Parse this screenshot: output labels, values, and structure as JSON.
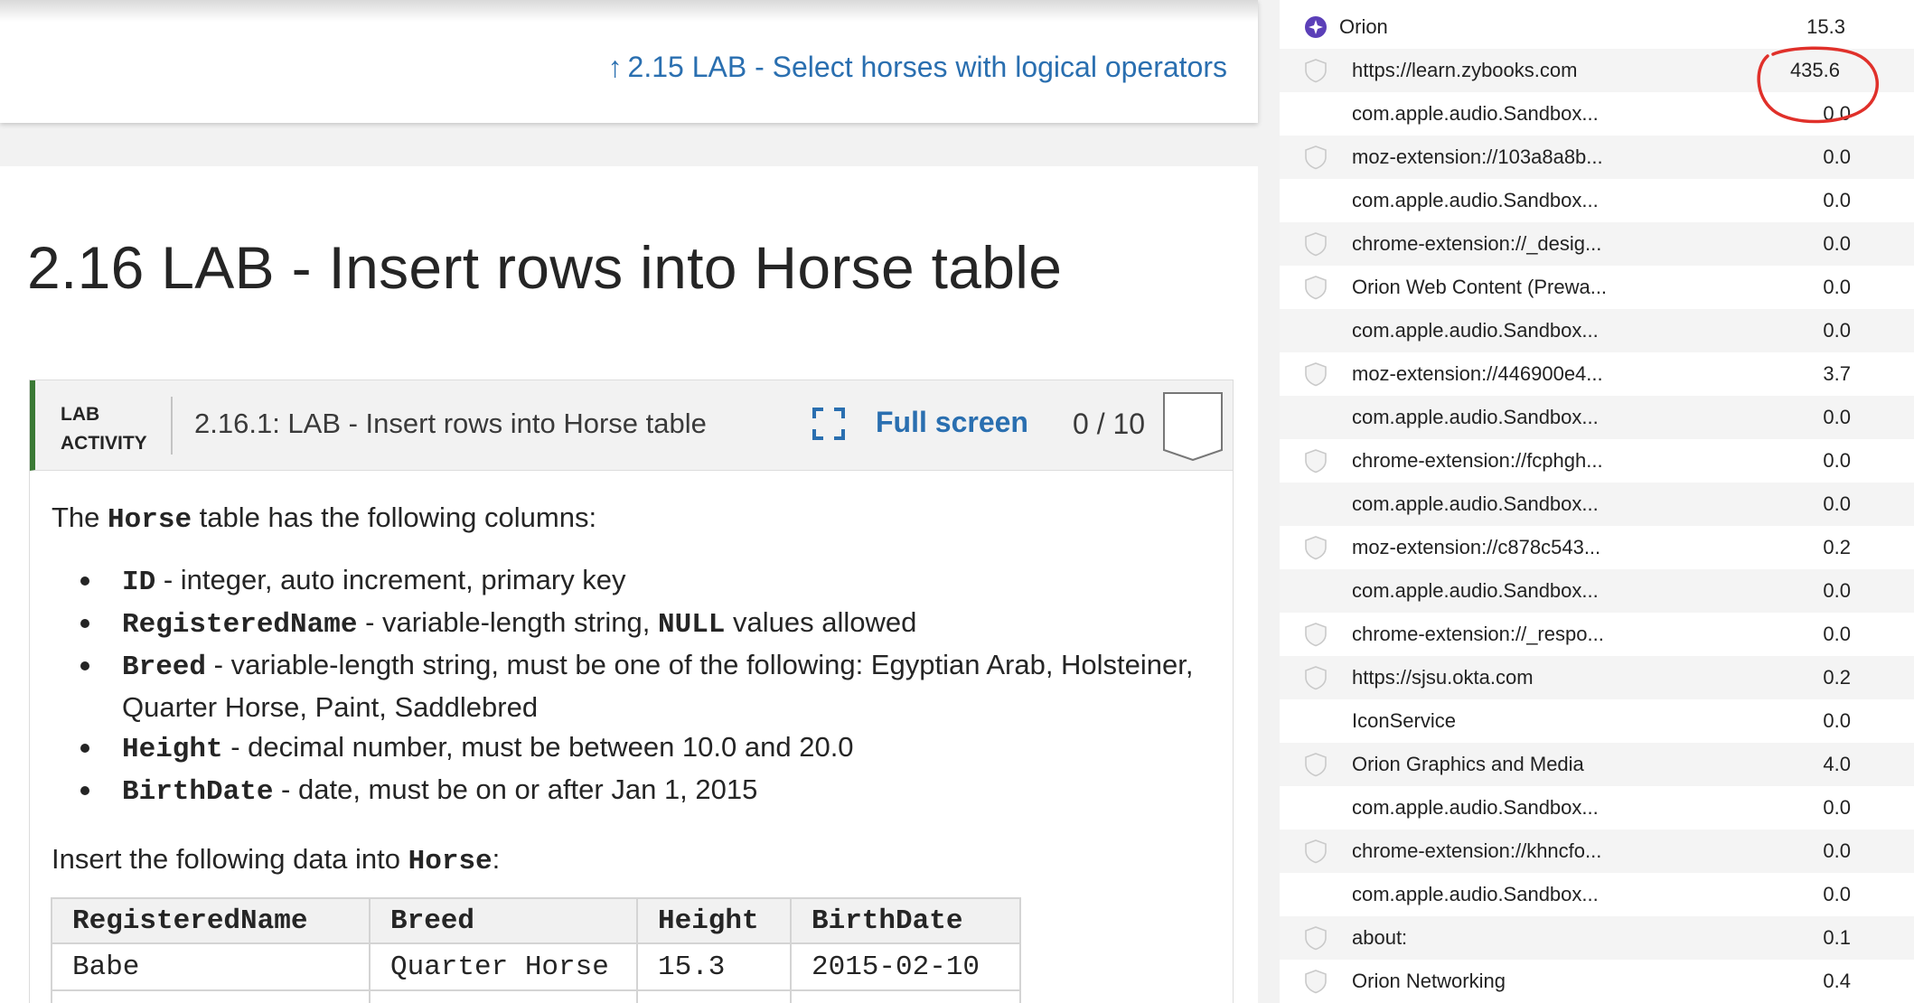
{
  "book": {
    "prev_section": "2.15 LAB - Select horses with logical operators",
    "title": "2.16 LAB - Insert rows into Horse table"
  },
  "lab": {
    "tag_line1": "LAB",
    "tag_line2": "ACTIVITY",
    "name": "2.16.1: LAB - Insert rows into Horse table",
    "fullscreen_label": "Full screen",
    "score": "0 / 10",
    "intro_pre": "The ",
    "intro_code": "Horse",
    "intro_post": " table has the following columns:",
    "columns": [
      {
        "code": "ID",
        "text": " - integer, auto increment, primary key"
      },
      {
        "code": "RegisteredName",
        "text": " - variable-length string, ",
        "code2": "NULL",
        "text2": " values allowed"
      },
      {
        "code": "Breed",
        "text": " - variable-length string, must be one of the following: Egyptian Arab, Holsteiner, Quarter Horse, Paint, Saddlebred"
      },
      {
        "code": "Height",
        "text": " - decimal number, must be between 10.0 and 20.0"
      },
      {
        "code": "BirthDate",
        "text": " - date, must be on or after Jan 1, 2015"
      }
    ],
    "insert_pre": "Insert the following data into ",
    "insert_code": "Horse",
    "insert_post": ":",
    "table": {
      "headers": [
        "RegisteredName",
        "Breed",
        "Height",
        "BirthDate"
      ],
      "rows": [
        [
          "Babe",
          "Quarter Horse",
          "15.3",
          "2015-02-10"
        ]
      ]
    }
  },
  "activity_monitor": {
    "rows": [
      {
        "name": "Orion",
        "value": "15.3",
        "icon": "orion-app-icon"
      },
      {
        "name": "https://learn.zybooks.com",
        "value": "435.6",
        "icon": "shield-icon"
      },
      {
        "name": "com.apple.audio.Sandbox...",
        "value": "0.0",
        "icon": ""
      },
      {
        "name": "moz-extension://103a8a8b...",
        "value": "0.0",
        "icon": "shield-icon"
      },
      {
        "name": "com.apple.audio.Sandbox...",
        "value": "0.0",
        "icon": ""
      },
      {
        "name": "chrome-extension://_desig...",
        "value": "0.0",
        "icon": "shield-icon"
      },
      {
        "name": "Orion Web Content (Prewa...",
        "value": "0.0",
        "icon": "shield-icon"
      },
      {
        "name": "com.apple.audio.Sandbox...",
        "value": "0.0",
        "icon": ""
      },
      {
        "name": "moz-extension://446900e4...",
        "value": "3.7",
        "icon": "shield-icon"
      },
      {
        "name": "com.apple.audio.Sandbox...",
        "value": "0.0",
        "icon": ""
      },
      {
        "name": "chrome-extension://fcphgh...",
        "value": "0.0",
        "icon": "shield-icon"
      },
      {
        "name": "com.apple.audio.Sandbox...",
        "value": "0.0",
        "icon": ""
      },
      {
        "name": "moz-extension://c878c543...",
        "value": "0.2",
        "icon": "shield-icon"
      },
      {
        "name": "com.apple.audio.Sandbox...",
        "value": "0.0",
        "icon": ""
      },
      {
        "name": "chrome-extension://_respo...",
        "value": "0.0",
        "icon": "shield-icon"
      },
      {
        "name": "https://sjsu.okta.com",
        "value": "0.2",
        "icon": "shield-icon"
      },
      {
        "name": "IconService",
        "value": "0.0",
        "icon": ""
      },
      {
        "name": "Orion Graphics and Media",
        "value": "4.0",
        "icon": "shield-icon"
      },
      {
        "name": "com.apple.audio.Sandbox...",
        "value": "0.0",
        "icon": ""
      },
      {
        "name": "chrome-extension://khncfo...",
        "value": "0.0",
        "icon": "shield-icon"
      },
      {
        "name": "com.apple.audio.Sandbox...",
        "value": "0.0",
        "icon": ""
      },
      {
        "name": "about:",
        "value": "0.1",
        "icon": "shield-icon"
      },
      {
        "name": "Orion Networking",
        "value": "0.4",
        "icon": "shield-icon"
      }
    ]
  },
  "colors": {
    "link_blue": "#2a6fb0",
    "lab_accent_green": "#3b7a35",
    "annotation_red": "#e0302a",
    "orion_purple": "#5b3fb8"
  }
}
